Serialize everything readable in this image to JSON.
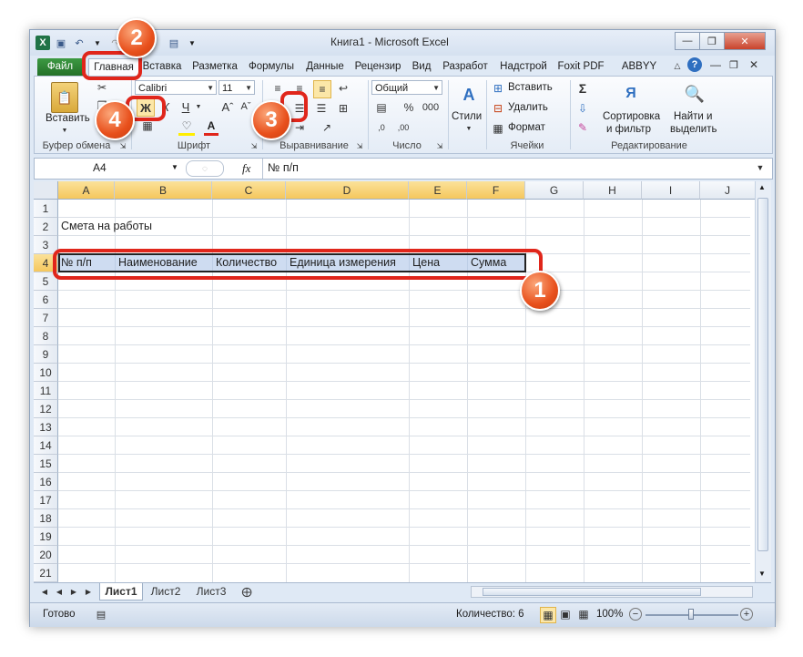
{
  "window": {
    "title": "Книга1 - Microsoft Excel"
  },
  "tabs": [
    "Файл",
    "Главная",
    "Вставка",
    "Разметка",
    "Формулы",
    "Данные",
    "Рецензир",
    "Вид",
    "Разработ",
    "Надстрой",
    "Foxit PDF",
    "ABBYY PDF"
  ],
  "ribbon": {
    "paste": "Вставить",
    "clipboard": "Буфер обмена",
    "font_name": "Calibri",
    "font_size": "11",
    "bold": "Ж",
    "italic": "К",
    "underline": "Ч",
    "font_group": "Шрифт",
    "align_group": "Выравнивание",
    "number_format": "Общий",
    "percent": "%",
    "thousands": "000",
    "number_group": "Число",
    "styles": "Стили",
    "insert": "Вставить",
    "delete": "Удалить",
    "format": "Формат",
    "cells_group": "Ячейки",
    "sort_line1": "Сортировка",
    "sort_line2": "и фильтр",
    "find_line1": "Найти и",
    "find_line2": "выделить",
    "editing_group": "Редактирование"
  },
  "formula_bar": {
    "name_box": "A4",
    "fx": "fx",
    "content": "№ п/п"
  },
  "columns": [
    "A",
    "B",
    "C",
    "D",
    "E",
    "F",
    "G",
    "H",
    "I",
    "J"
  ],
  "rows": [
    "1",
    "2",
    "3",
    "4",
    "5",
    "6",
    "7",
    "8",
    "9",
    "10",
    "11",
    "12",
    "13",
    "14",
    "15",
    "16",
    "17",
    "18",
    "19",
    "20",
    "21"
  ],
  "cells": {
    "A2": "Смета на работы",
    "A4": "№ п/п",
    "B4": "Наименование",
    "C4": "Количество",
    "D4": "Единица измерения",
    "E4": "Цена",
    "F4": "Сумма"
  },
  "sheets": [
    "Лист1",
    "Лист2",
    "Лист3"
  ],
  "status": {
    "ready": "Готово",
    "count": "Количество: 6",
    "zoom": "100%"
  },
  "callouts": [
    "1",
    "2",
    "3",
    "4"
  ],
  "colors": {
    "callout": "#e0261b",
    "file_tab": "#2e7d32",
    "selection_header": "#f5c75d"
  }
}
